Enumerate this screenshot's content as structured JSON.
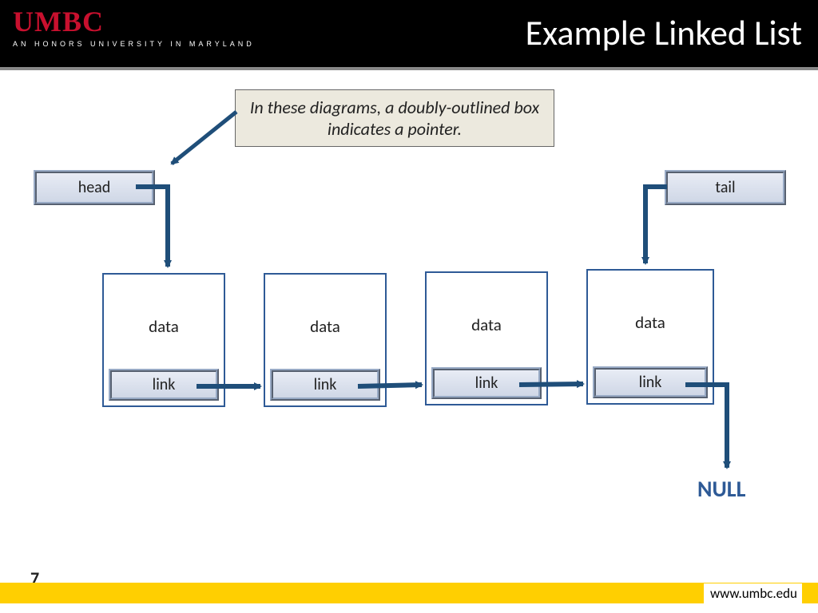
{
  "header": {
    "logo": "UMBC",
    "logo_sub": "AN HONORS UNIVERSITY IN MARYLAND",
    "title": "Example Linked List"
  },
  "callout": "In these diagrams, a doubly-outlined box indicates a pointer.",
  "pointers": {
    "head": "head",
    "tail": "tail"
  },
  "nodes": [
    {
      "data": "data",
      "link": "link"
    },
    {
      "data": "data",
      "link": "link"
    },
    {
      "data": "data",
      "link": "link"
    },
    {
      "data": "data",
      "link": "link"
    }
  ],
  "null_label": "NULL",
  "footer": {
    "page": "7",
    "url": "www.umbc.edu"
  },
  "colors": {
    "arrow": "#1f4e79"
  }
}
